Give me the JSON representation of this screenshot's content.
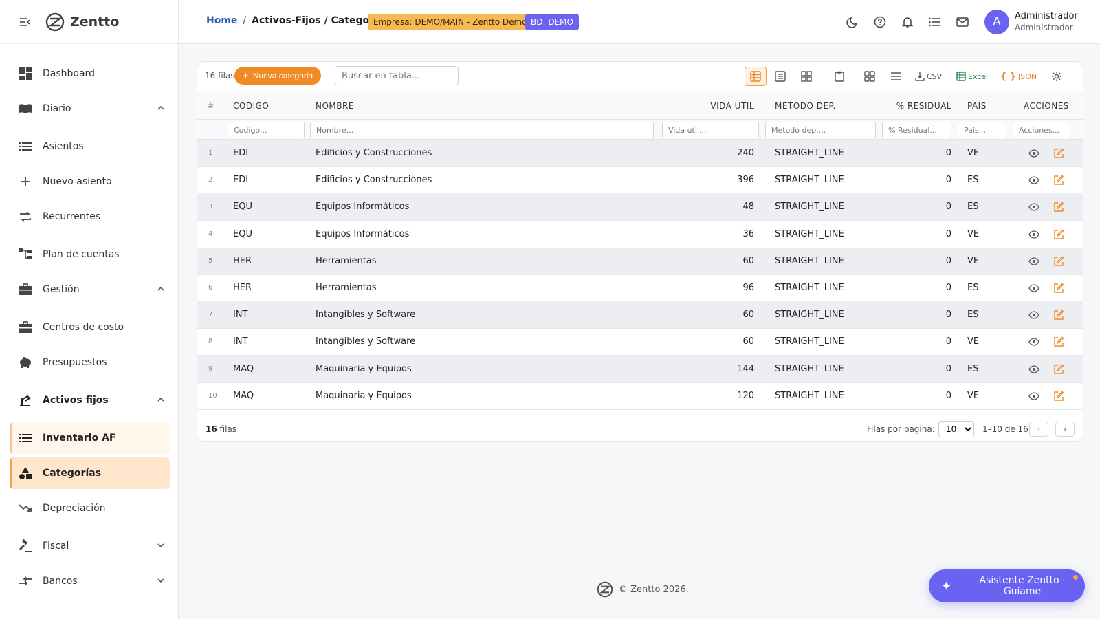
{
  "brand": {
    "name": "Zentto"
  },
  "sidebar": {
    "items": [
      {
        "label": "Dashboard"
      },
      {
        "label": "Diario"
      },
      {
        "label": "Asientos"
      },
      {
        "label": "Nuevo asiento"
      },
      {
        "label": "Recurrentes"
      },
      {
        "label": "Plan de cuentas"
      },
      {
        "label": "Gestión"
      },
      {
        "label": "Centros de costo"
      },
      {
        "label": "Presupuestos"
      },
      {
        "label": "Activos fijos"
      },
      {
        "label": "Inventario AF"
      },
      {
        "label": "Categorías"
      },
      {
        "label": "Depreciación"
      },
      {
        "label": "Fiscal"
      },
      {
        "label": "Bancos"
      }
    ]
  },
  "header": {
    "home": "Home",
    "separator": "/",
    "path": "Activos-Fijos / Categorias",
    "empresa_badge": "Empresa: DEMO/MAIN - Zentto Demo",
    "db_badge": "BD: DEMO",
    "user_initial": "A",
    "user_name": "Administrador",
    "user_role": "Administrador"
  },
  "toolbar": {
    "count_label": "16 filas",
    "new_label": "Nueva categoria",
    "search_placeholder": "Buscar en tabla...",
    "csv_label": "CSV",
    "excel_label": "Excel",
    "json_label": "JSON"
  },
  "table": {
    "headers": [
      "#",
      "CODIGO",
      "NOMBRE",
      "VIDA UTIL",
      "METODO DEP.",
      "% RESIDUAL",
      "PAIS",
      "ACCIONES"
    ],
    "filters": [
      "Codigo...",
      "Nombre...",
      "Vida util...",
      "Metodo dep....",
      "% Residual...",
      "Pais...",
      "Acciones..."
    ],
    "rows": [
      {
        "n": "1",
        "codigo": "EDI",
        "nombre": "Edificios y Construcciones",
        "vida": "240",
        "metodo": "STRAIGHT_LINE",
        "residual": "0",
        "pais": "VE"
      },
      {
        "n": "2",
        "codigo": "EDI",
        "nombre": "Edificios y Construcciones",
        "vida": "396",
        "metodo": "STRAIGHT_LINE",
        "residual": "0",
        "pais": "ES"
      },
      {
        "n": "3",
        "codigo": "EQU",
        "nombre": "Equipos Informáticos",
        "vida": "48",
        "metodo": "STRAIGHT_LINE",
        "residual": "0",
        "pais": "ES"
      },
      {
        "n": "4",
        "codigo": "EQU",
        "nombre": "Equipos Informáticos",
        "vida": "36",
        "metodo": "STRAIGHT_LINE",
        "residual": "0",
        "pais": "VE"
      },
      {
        "n": "5",
        "codigo": "HER",
        "nombre": "Herramientas",
        "vida": "60",
        "metodo": "STRAIGHT_LINE",
        "residual": "0",
        "pais": "VE"
      },
      {
        "n": "6",
        "codigo": "HER",
        "nombre": "Herramientas",
        "vida": "96",
        "metodo": "STRAIGHT_LINE",
        "residual": "0",
        "pais": "ES"
      },
      {
        "n": "7",
        "codigo": "INT",
        "nombre": "Intangibles y Software",
        "vida": "60",
        "metodo": "STRAIGHT_LINE",
        "residual": "0",
        "pais": "ES"
      },
      {
        "n": "8",
        "codigo": "INT",
        "nombre": "Intangibles y Software",
        "vida": "60",
        "metodo": "STRAIGHT_LINE",
        "residual": "0",
        "pais": "VE"
      },
      {
        "n": "9",
        "codigo": "MAQ",
        "nombre": "Maquinaria y Equipos",
        "vida": "144",
        "metodo": "STRAIGHT_LINE",
        "residual": "0",
        "pais": "ES"
      },
      {
        "n": "10",
        "codigo": "MAQ",
        "nombre": "Maquinaria y Equipos",
        "vida": "120",
        "metodo": "STRAIGHT_LINE",
        "residual": "0",
        "pais": "VE"
      }
    ]
  },
  "footer_bar": {
    "total_count": "16",
    "total_suffix": "filas",
    "per_page_label": "Filas por pagina:",
    "per_page_value": "10",
    "range": "1–10 de 16",
    "prev": "‹",
    "next": "›"
  },
  "page_footer": {
    "copyright": "© Zentto 2026."
  },
  "assistant": {
    "label": "Asistente Zentto · Guíame"
  },
  "colors": {
    "accent": "#f08a24",
    "brand": "#6a63f2",
    "link": "#2a5db0",
    "edit_icon": "#f08a24"
  }
}
